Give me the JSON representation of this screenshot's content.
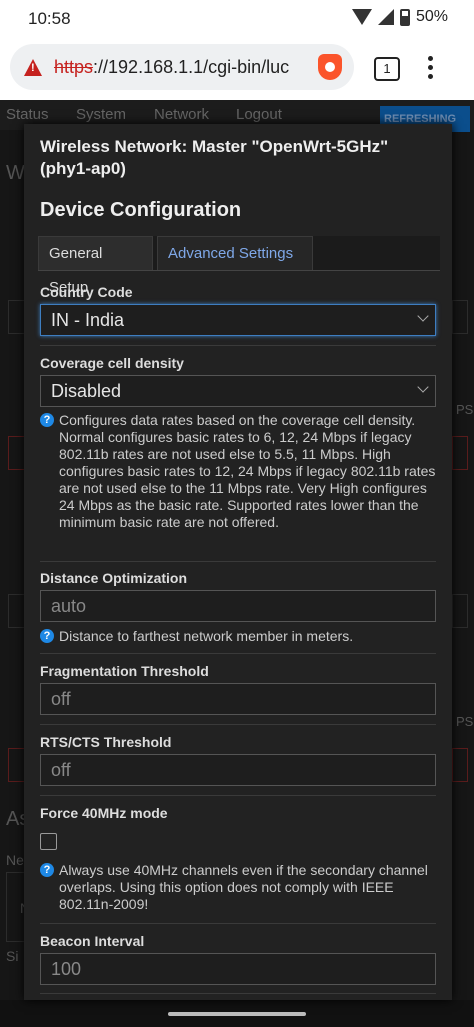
{
  "status_bar": {
    "time": "10:58",
    "battery": "50%"
  },
  "browser": {
    "url_scheme": "https",
    "url_rest": "://192.168.1.1/cgi-bin/luc",
    "tab_count": "1"
  },
  "background": {
    "nav": [
      "Status",
      "System",
      "Network",
      "Logout"
    ],
    "refreshing": "REFRESHING",
    "fragments": [
      "W",
      "PS",
      "PS",
      "As",
      "Ne",
      "N",
      "Si"
    ]
  },
  "modal": {
    "title": "Wireless Network: Master \"OpenWrt-5GHz\" (phy1-ap0)",
    "section": "Device Configuration",
    "tabs": {
      "general": "General Setup",
      "advanced": "Advanced Settings"
    },
    "country": {
      "label": "Country Code",
      "value": "IN - India"
    },
    "coverage": {
      "label": "Coverage cell density",
      "value": "Disabled",
      "hint": "Configures data rates based on the coverage cell density. Normal configures basic rates to 6, 12, 24 Mbps if legacy 802.11b rates are not used else to 5.5, 11 Mbps. High configures basic rates to 12, 24 Mbps if legacy 802.11b rates are not used else to the 11 Mbps rate. Very High configures 24 Mbps as the basic rate. Supported rates lower than the minimum basic rate are not offered."
    },
    "distance": {
      "label": "Distance Optimization",
      "placeholder": "auto",
      "hint": "Distance to farthest network member in meters."
    },
    "fragmentation": {
      "label": "Fragmentation Threshold",
      "placeholder": "off"
    },
    "rts": {
      "label": "RTS/CTS Threshold",
      "placeholder": "off"
    },
    "force40": {
      "label": "Force 40MHz mode",
      "hint": "Always use 40MHz channels even if the secondary channel overlaps. Using this option does not comply with IEEE 802.11n-2009!"
    },
    "beacon": {
      "label": "Beacon Interval",
      "placeholder": "100"
    }
  },
  "colors": {
    "accent": "#3e7ec1",
    "tab_active": "#7fa8e8",
    "hint_icon": "#1e88e5",
    "warning": "#c5221f"
  }
}
